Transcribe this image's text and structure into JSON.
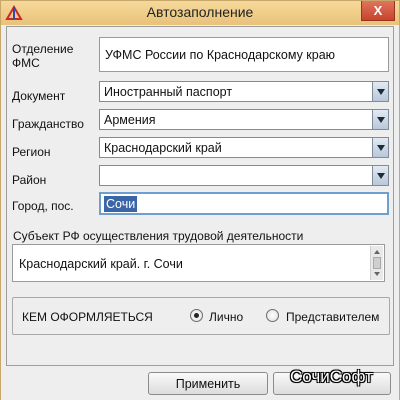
{
  "window": {
    "title": "Автозаполнение",
    "close_glyph": "X"
  },
  "form": {
    "fms": {
      "label_line1": "Отделение",
      "label_line2": "ФМС",
      "value": "УФМС России по Краснодарскому краю"
    },
    "document": {
      "label": "Документ",
      "value": "Иностранный паспорт"
    },
    "citizenship": {
      "label": "Гражданство",
      "value": "Армения"
    },
    "region": {
      "label": "Регион",
      "value": "Краснодарский край"
    },
    "district": {
      "label": "Район",
      "value": ""
    },
    "city": {
      "label": "Город, пос.",
      "value": "Сочи"
    },
    "subject": {
      "label": "Субъект РФ осуществления трудовой деятельности",
      "value": "Краснодарский край. г. Сочи"
    }
  },
  "who": {
    "label": "КЕМ ОФОРМЛЯЕТЬСЯ",
    "options": [
      {
        "label": "Лично",
        "checked": true
      },
      {
        "label": "Представителем",
        "checked": false
      }
    ]
  },
  "buttons": {
    "apply": "Применить"
  },
  "watermark": "СочиСофт",
  "icons": {
    "title": "app-logo-icon",
    "close": "close-icon"
  }
}
